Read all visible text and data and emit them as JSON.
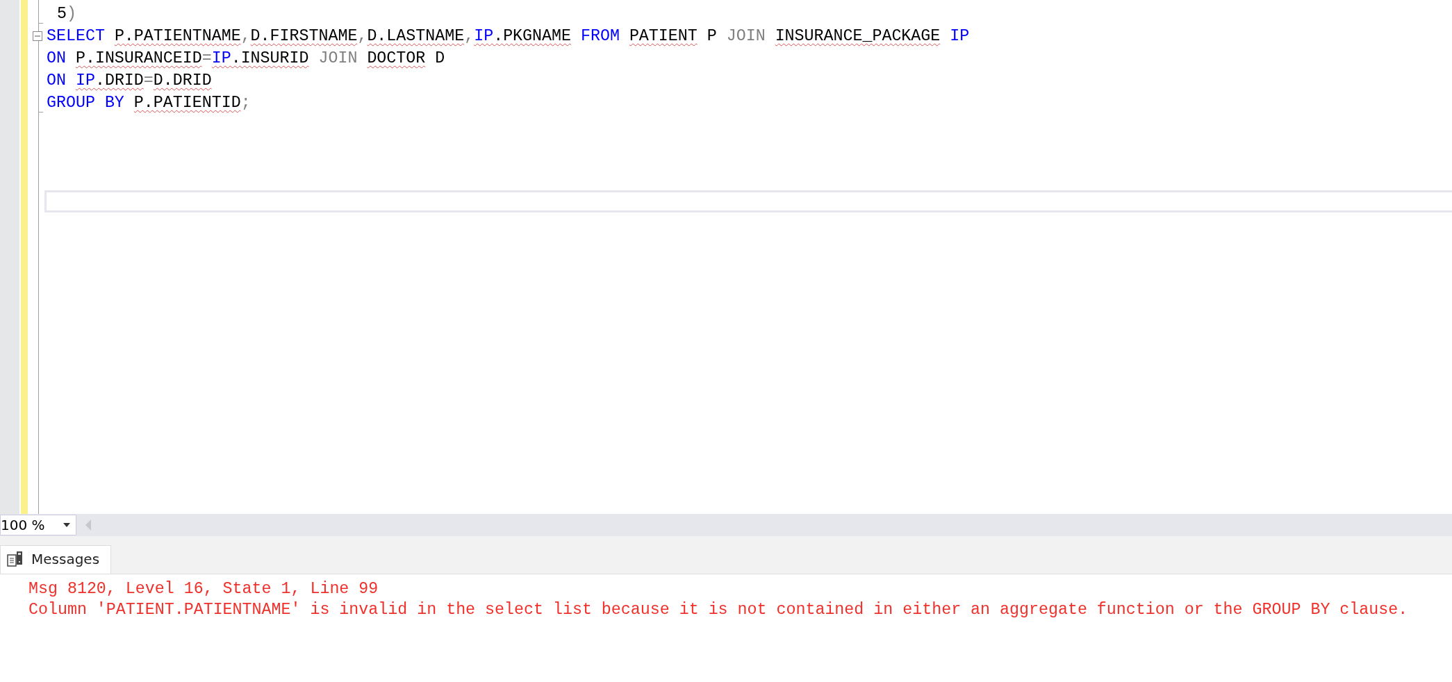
{
  "editor": {
    "lines": [
      {
        "folded_start": false,
        "tokens": [
          {
            "text": "5",
            "kind": "name",
            "flagged": false
          },
          {
            "text": ")",
            "kind": "punctuation",
            "flagged": false
          }
        ]
      },
      {
        "folded_start": true,
        "tokens": [
          {
            "text": "SELECT ",
            "kind": "keyword",
            "flagged": false
          },
          {
            "text": "P.PATIENTNAME",
            "kind": "name",
            "flagged": true
          },
          {
            "text": ",",
            "kind": "punctuation",
            "flagged": false
          },
          {
            "text": "D.FIRSTNAME",
            "kind": "name",
            "flagged": true
          },
          {
            "text": ",",
            "kind": "punctuation",
            "flagged": false
          },
          {
            "text": "D.LASTNAME",
            "kind": "name",
            "flagged": true
          },
          {
            "text": ",",
            "kind": "punctuation",
            "flagged": false
          },
          {
            "text": "IP",
            "kind": "alias",
            "flagged": true
          },
          {
            "text": ".PKGNAME",
            "kind": "name",
            "flagged": true
          },
          {
            "text": " FROM ",
            "kind": "keyword",
            "flagged": false
          },
          {
            "text": "PATIENT",
            "kind": "name",
            "flagged": true
          },
          {
            "text": " P ",
            "kind": "name",
            "flagged": false
          },
          {
            "text": "JOIN ",
            "kind": "join",
            "flagged": false
          },
          {
            "text": "INSURANCE_PACKAGE",
            "kind": "name",
            "flagged": true
          },
          {
            "text": " IP",
            "kind": "keyword",
            "flagged": false
          }
        ]
      },
      {
        "folded_start": false,
        "tokens": [
          {
            "text": "ON ",
            "kind": "keyword",
            "flagged": false
          },
          {
            "text": "P.INSURANCEID",
            "kind": "name",
            "flagged": true
          },
          {
            "text": "=",
            "kind": "punctuation",
            "flagged": false
          },
          {
            "text": "IP",
            "kind": "alias",
            "flagged": true
          },
          {
            "text": ".INSURID",
            "kind": "name",
            "flagged": true
          },
          {
            "text": " JOIN ",
            "kind": "join",
            "flagged": false
          },
          {
            "text": "DOCTOR",
            "kind": "name",
            "flagged": true
          },
          {
            "text": " D",
            "kind": "name",
            "flagged": false
          }
        ]
      },
      {
        "folded_start": false,
        "tokens": [
          {
            "text": "ON ",
            "kind": "keyword",
            "flagged": false
          },
          {
            "text": "IP",
            "kind": "alias",
            "flagged": true
          },
          {
            "text": ".DRID",
            "kind": "name",
            "flagged": true
          },
          {
            "text": "=",
            "kind": "punctuation",
            "flagged": false
          },
          {
            "text": "D.DRID",
            "kind": "name",
            "flagged": true
          }
        ]
      },
      {
        "folded_start": false,
        "tokens": [
          {
            "text": "GROUP BY ",
            "kind": "keyword",
            "flagged": false
          },
          {
            "text": "P.PATIENTID",
            "kind": "name",
            "flagged": true
          },
          {
            "text": ";",
            "kind": "punctuation",
            "flagged": false
          }
        ]
      }
    ]
  },
  "zoom": {
    "value": "100 %"
  },
  "results": {
    "tabs": [
      {
        "label": "Messages",
        "selected": true
      }
    ],
    "messages": [
      "Msg 8120, Level 16, State 1, Line 99",
      "Column 'PATIENT.PATIENTNAME' is invalid in the select list because it is not contained in either an aggregate function or the GROUP BY clause."
    ]
  }
}
